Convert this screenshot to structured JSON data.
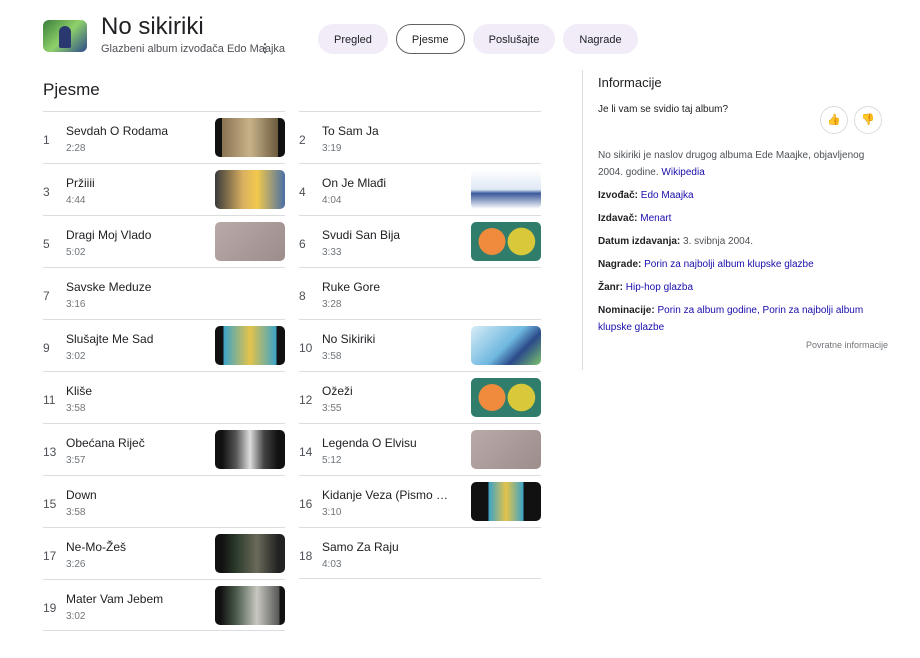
{
  "header": {
    "title": "No sikiriki",
    "subtitle": "Glazbeni album izvođača Edo Maajka",
    "more": "⋮"
  },
  "tabs": [
    {
      "label": "Pregled"
    },
    {
      "label": "Pjesme"
    },
    {
      "label": "Poslušajte"
    },
    {
      "label": "Nagrade"
    }
  ],
  "section_title": "Pjesme",
  "tracks": [
    {
      "n": "1",
      "title": "Sevdah O Rodama",
      "dur": "2:28",
      "thumb": "linear-gradient(90deg,#111 10%,#8a7350 10%,#c8b28a 50%,#6b5a3d 90%,#111 90%)"
    },
    {
      "n": "2",
      "title": "To Sam Ja",
      "dur": "3:19",
      "thumb": ""
    },
    {
      "n": "3",
      "title": "Pržiiii",
      "dur": "4:44",
      "thumb": "linear-gradient(90deg,#3a3a3a,#d9b060 40%,#f2c94c 60%,#4a6fa5)"
    },
    {
      "n": "4",
      "title": "On Je Mlađi",
      "dur": "4:04",
      "thumb": "linear-gradient(180deg,#fff,#dfe8f5 50%,#3a5a9a 60%,#fff)"
    },
    {
      "n": "5",
      "title": "Dragi Moj Vlado",
      "dur": "5:02",
      "thumb": "linear-gradient(135deg,#b9aaa8,#9c8d8b)"
    },
    {
      "n": "6",
      "title": "Svudi San Bija",
      "dur": "3:33",
      "thumb": "radial-gradient(circle at 30% 50%,#f08a3c 25%,transparent 26%),radial-gradient(circle at 72% 50%,#d8c83a 25%,#2f7d6a 26%)"
    },
    {
      "n": "7",
      "title": "Savske Meduze",
      "dur": "3:16",
      "thumb": ""
    },
    {
      "n": "8",
      "title": "Ruke Gore",
      "dur": "3:28",
      "thumb": ""
    },
    {
      "n": "9",
      "title": "Slušajte Me Sad",
      "dur": "3:02",
      "thumb": "linear-gradient(90deg,#111 12%,#3aa3c9 12%,#e4c34a 50%,#3aa3c9 88%,#111 88%)"
    },
    {
      "n": "10",
      "title": "No Sikiriki",
      "dur": "3:58",
      "thumb": "linear-gradient(135deg,#d7ecf7,#6fb8e0 50%,#2b4a8a 70%,#7bc36a)"
    },
    {
      "n": "11",
      "title": "Kliše",
      "dur": "3:58",
      "thumb": ""
    },
    {
      "n": "12",
      "title": "Ožeži",
      "dur": "3:55",
      "thumb": "radial-gradient(circle at 30% 50%,#f08a3c 25%,transparent 26%),radial-gradient(circle at 72% 50%,#d8c83a 25%,#2f7d6a 26%)"
    },
    {
      "n": "13",
      "title": "Obećana Riječ",
      "dur": "3:57",
      "thumb": "linear-gradient(90deg,#111 10%,#555 30%,#ddd 50%,#444 70%,#111 90%)"
    },
    {
      "n": "14",
      "title": "Legenda O Elvisu",
      "dur": "5:12",
      "thumb": "linear-gradient(135deg,#b9aaa8,#9c8d8b)"
    },
    {
      "n": "15",
      "title": "Down",
      "dur": "3:58",
      "thumb": ""
    },
    {
      "n": "16",
      "title": "Kidanje Veza (Pismo …",
      "dur": "3:10",
      "thumb": "linear-gradient(90deg,#111 25%,#3aa3c9 25%,#e4c34a 50%,#3aa3c9 75%,#111 75%)"
    },
    {
      "n": "17",
      "title": "Ne-Mo-Žeš",
      "dur": "3:26",
      "thumb": "linear-gradient(90deg,#111 10%,#2c3a2c 30%,#6a6a5a 60%,#222 90%)"
    },
    {
      "n": "18",
      "title": "Samo Za Raju",
      "dur": "4:03",
      "thumb": ""
    },
    {
      "n": "19",
      "title": "Mater Vam Jebem",
      "dur": "3:02",
      "thumb": "linear-gradient(90deg,#111 8%,#4a5a4a 30%,#c8c8c0 60%,#555 92%,#111 92%)"
    }
  ],
  "info": {
    "title": "Informacije",
    "question": "Je li vam se svidio taj album?",
    "like": "👍",
    "dislike": "👎",
    "description": "No sikiriki je naslov drugog albuma Ede Maajke, objavljenog 2004. godine.",
    "wiki": "Wikipedia",
    "facts": [
      {
        "label": "Izvođač:",
        "value": "Edo Maajka",
        "link": true
      },
      {
        "label": "Izdavač:",
        "value": "Menart",
        "link": true
      },
      {
        "label": "Datum izdavanja:",
        "value": "3. svibnja 2004.",
        "link": false
      },
      {
        "label": "Nagrade:",
        "value": "Porin za najbolji album klupske glazbe",
        "link": true
      },
      {
        "label": "Žanr:",
        "value": "Hip-hop glazba",
        "link": true
      },
      {
        "label": "Nominacije:",
        "value": "Porin za album godine, Porin za najbolji album klupske glazbe",
        "link": true
      }
    ],
    "feedback": "Povratne informacije"
  }
}
